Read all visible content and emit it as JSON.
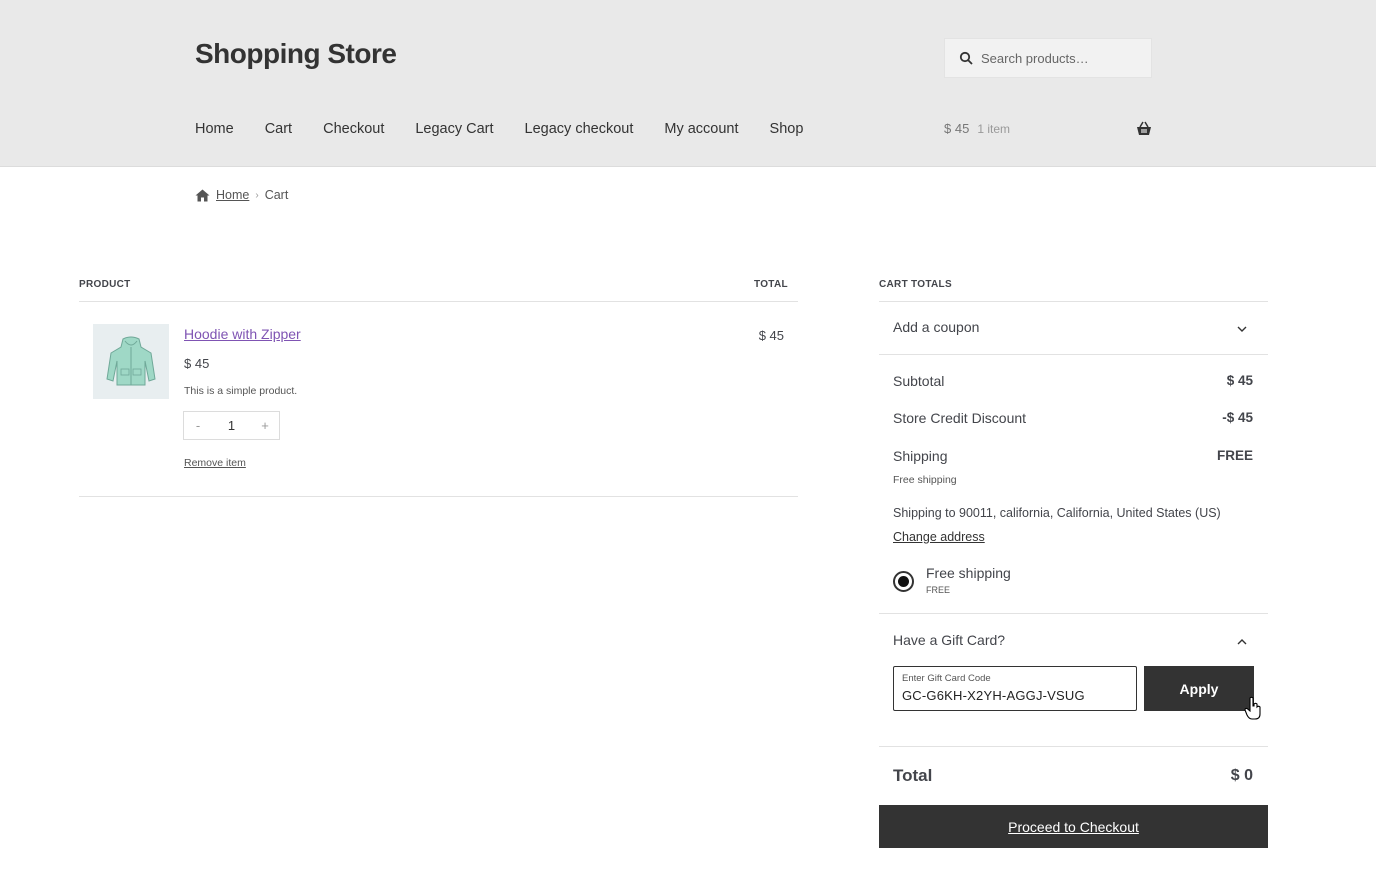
{
  "header": {
    "site_title": "Shopping Store",
    "search_placeholder": "Search products…",
    "nav": [
      "Home",
      "Cart",
      "Checkout",
      "Legacy Cart",
      "Legacy checkout",
      "My account",
      "Shop"
    ],
    "mini_cart": {
      "price": "$ 45",
      "count": "1 item"
    }
  },
  "breadcrumb": {
    "home": "Home",
    "sep": "›",
    "current": "Cart"
  },
  "cart_table": {
    "headers": {
      "product": "PRODUCT",
      "total": "TOTAL"
    },
    "items": [
      {
        "name": "Hoodie with Zipper",
        "price": "$ 45",
        "description": "This is a simple product.",
        "qty_minus": "-",
        "quantity": "1",
        "qty_plus": "+",
        "remove": "Remove item",
        "line_total": "$ 45"
      }
    ]
  },
  "totals": {
    "heading": "CART TOTALS",
    "coupon": "Add a coupon",
    "subtotal_label": "Subtotal",
    "subtotal_value": "$ 45",
    "discount_label": "Store Credit Discount",
    "discount_value": "-$ 45",
    "shipping_label": "Shipping",
    "shipping_value": "FREE",
    "shipping_method": "Free shipping",
    "shipping_to": "Shipping to 90011, california, California, United States (US)",
    "change_address": "Change address",
    "option_label": "Free shipping",
    "option_price": "FREE",
    "gift_card_heading": "Have a Gift Card?",
    "gift_card_label": "Enter Gift Card Code",
    "gift_card_value": "GC-G6KH-X2YH-AGGJ-VSUG",
    "apply": "Apply",
    "total_label": "Total",
    "total_value": "$ 0",
    "checkout": "Proceed to Checkout"
  },
  "colors": {
    "header_bg": "#e9e9e9",
    "button_bg": "#333333",
    "link_purple": "#7f54b3"
  }
}
